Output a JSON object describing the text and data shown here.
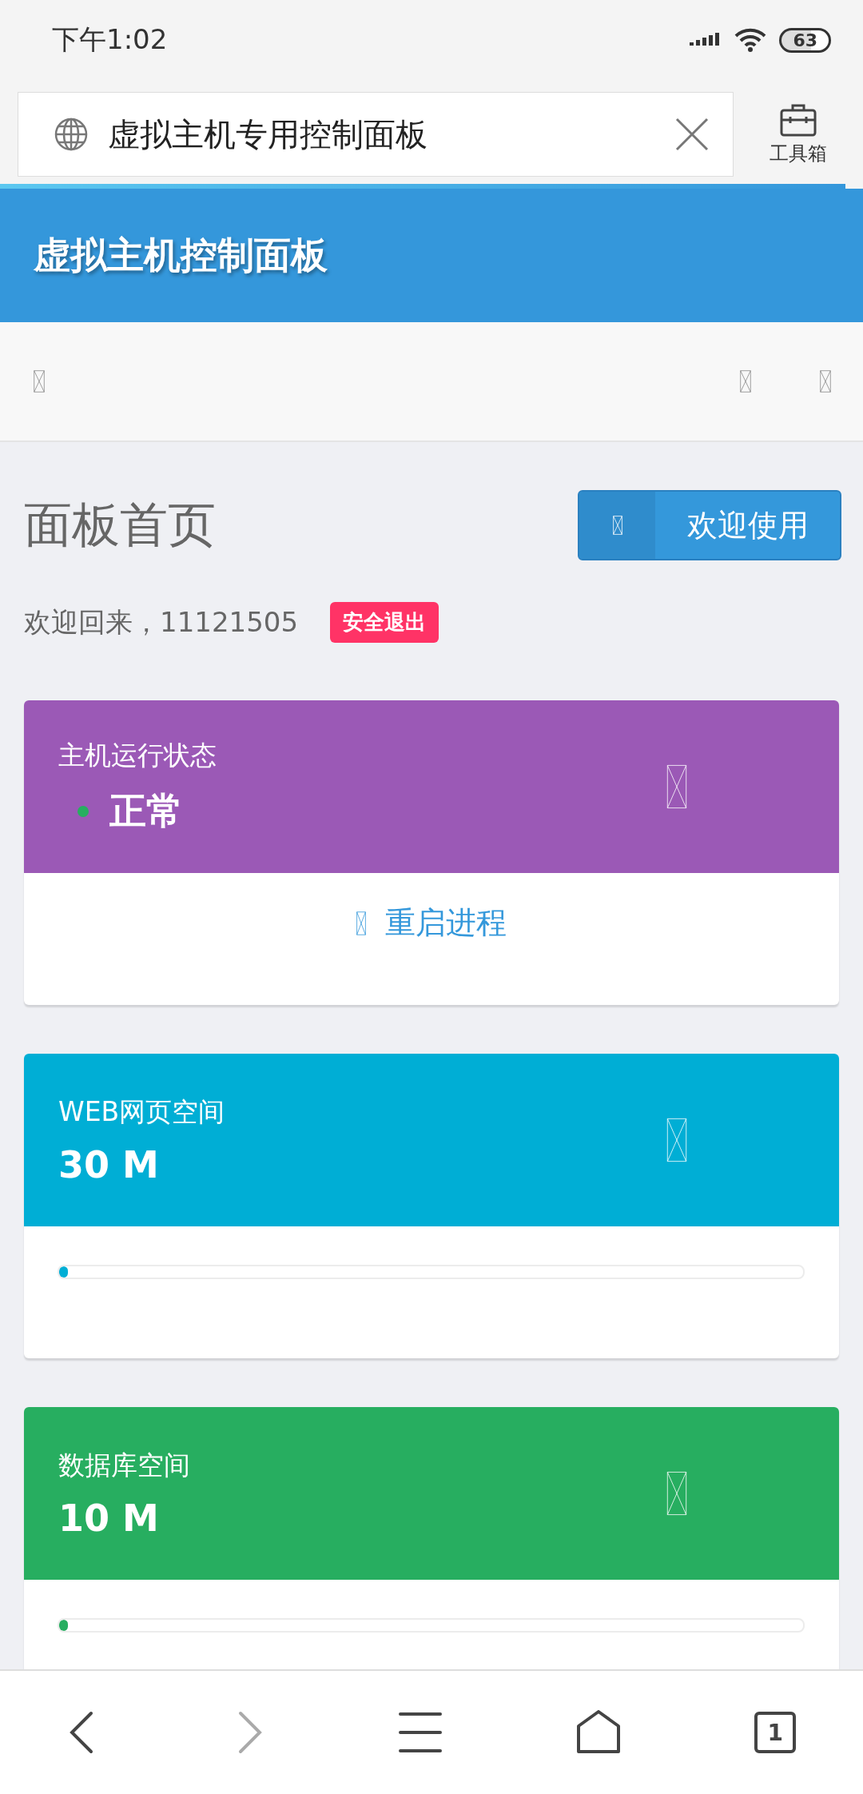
{
  "status_bar": {
    "time": "下午1:02",
    "battery": "63"
  },
  "address_bar": {
    "value": "虚拟主机专用控制面板",
    "tools_label": "工具箱",
    "load": {
      "level": 0.98
    }
  },
  "header": {
    "title": "虚拟主机控制面板"
  },
  "page": {
    "title": "面板首页",
    "welcome_button": "欢迎使用",
    "greeting": "欢迎回来，11121505",
    "logout": "安全退出"
  },
  "cards": [
    {
      "kind": "status",
      "label": "主机运行状态",
      "value": "正常",
      "color": "#9b59b6",
      "dot": {
        "color": "#27ae60"
      },
      "action": "重启进程"
    },
    {
      "kind": "progress",
      "label": "WEB网页空间",
      "value": "30 M",
      "color": "#00aed5",
      "level": 0.01
    },
    {
      "kind": "progress",
      "label": "数据库空间",
      "value": "10 M",
      "color": "#27ae60",
      "level": 0.01
    }
  ],
  "bottom_nav": {
    "tabs": "1"
  }
}
